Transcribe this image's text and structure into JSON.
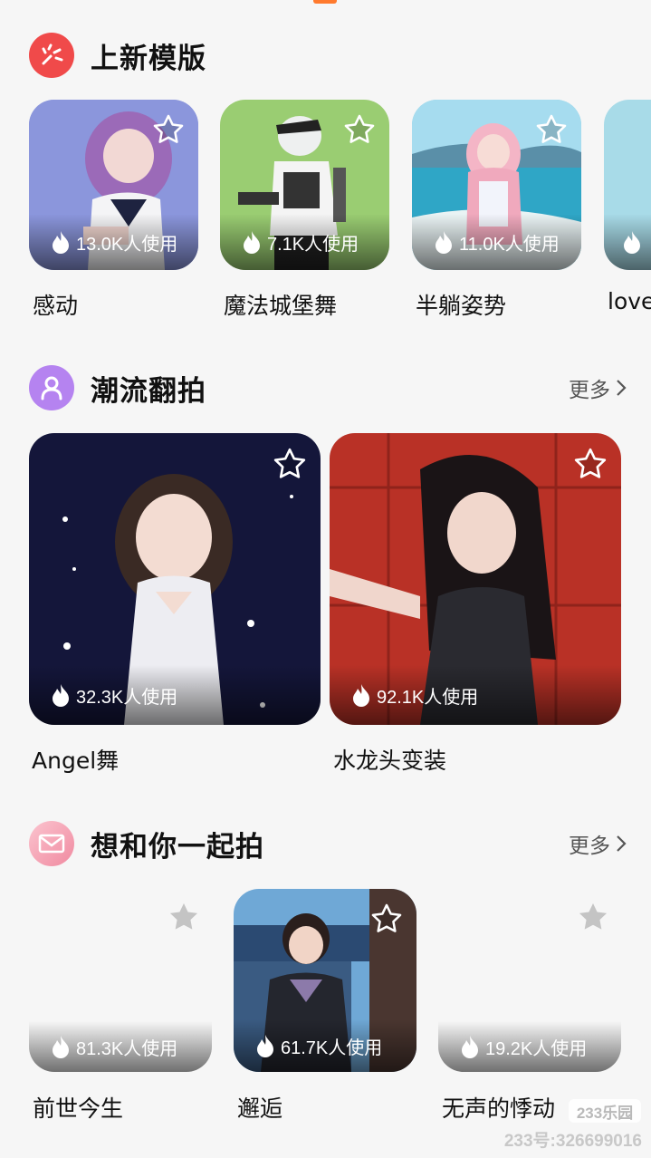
{
  "sections": [
    {
      "title": "上新模版",
      "cards": [
        {
          "label": "感动",
          "usage": "13.0K人使用"
        },
        {
          "label": "魔法城堡舞",
          "usage": "7.1K人使用"
        },
        {
          "label": "半躺姿势",
          "usage": "11.0K人使用"
        },
        {
          "label": "love"
        }
      ]
    },
    {
      "title": "潮流翻拍",
      "more": "更多",
      "cards": [
        {
          "label": "Angel舞",
          "usage": "32.3K人使用"
        },
        {
          "label": "水龙头变装",
          "usage": "92.1K人使用"
        }
      ]
    },
    {
      "title": "想和你一起拍",
      "more": "更多",
      "cards": [
        {
          "label": "前世今生",
          "usage": "81.3K人使用"
        },
        {
          "label": "邂逅",
          "usage": "61.7K人使用"
        },
        {
          "label": "无声的悸动",
          "usage": "19.2K人使用"
        }
      ]
    }
  ],
  "watermark": {
    "badge": "233乐园",
    "id": "233号:326699016"
  },
  "colors": {
    "accent": "#ff7a2e",
    "sec1_icon": "#f04a4a",
    "sec2_icon": "#b583f0",
    "sec3_icon": "#f4a0b0"
  }
}
